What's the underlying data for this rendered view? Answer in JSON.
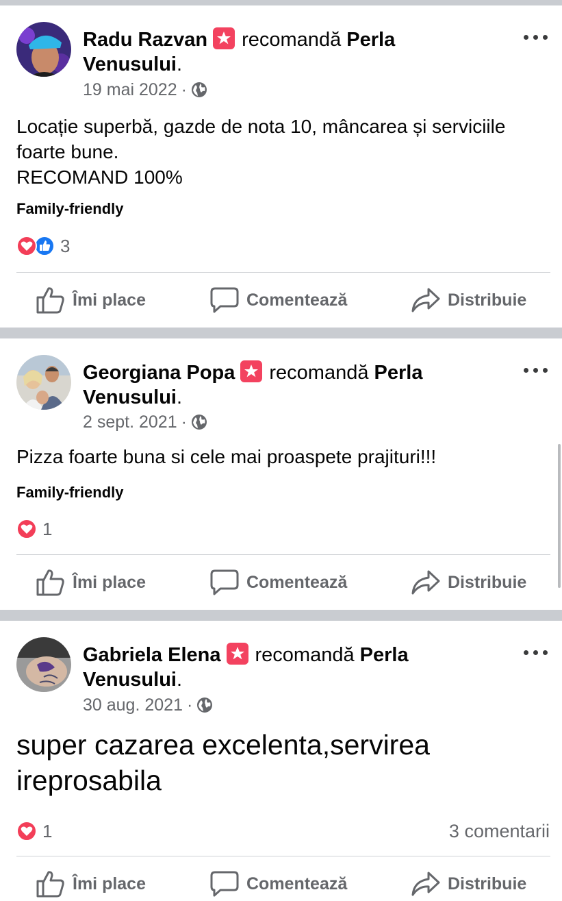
{
  "posts": [
    {
      "author": "Radu Razvan",
      "recommends_text": "recomandă",
      "page_name_part1": "Perla",
      "page_name_part2": "Venusului",
      "page_suffix": ".",
      "date": "19 mai 2022",
      "dot": "·",
      "body_lines": [
        "Locație superbă, gazde de nota 10, mâncarea și serviciile",
        "foarte bune.",
        "RECOMAND 100%"
      ],
      "tag": "Family-friendly",
      "reaction_count": "3",
      "reactions": [
        "love-icon",
        "like-icon"
      ]
    },
    {
      "author": "Georgiana Popa",
      "recommends_text": "recomandă",
      "page_name_part1": "Perla",
      "page_name_part2": "Venusului",
      "page_suffix": ".",
      "date": "2 sept. 2021",
      "dot": "·",
      "body_lines": [
        "Pizza foarte buna si cele mai proaspete prajituri!!!"
      ],
      "tag": "Family-friendly",
      "reaction_count": "1",
      "reactions": [
        "love-icon"
      ]
    },
    {
      "author": "Gabriela Elena",
      "recommends_text": "recomandă",
      "page_name_part1": "Perla",
      "page_name_part2": "Venusului",
      "page_suffix": ".",
      "date": "30 aug. 2021",
      "dot": "·",
      "body_lines": [
        "super cazarea excelenta,servirea",
        "ireprosabila"
      ],
      "reaction_count": "1",
      "comments_count": "3 comentarii",
      "reactions": [
        "love-icon"
      ]
    }
  ],
  "actions": {
    "like": "Îmi place",
    "comment": "Comentează",
    "share": "Distribuie"
  },
  "colors": {
    "separator": "#c9ccd1",
    "secondary_text": "#65676b",
    "recommend_badge": "#f3425f",
    "love": "#f33e58",
    "like": "#1877f2"
  }
}
